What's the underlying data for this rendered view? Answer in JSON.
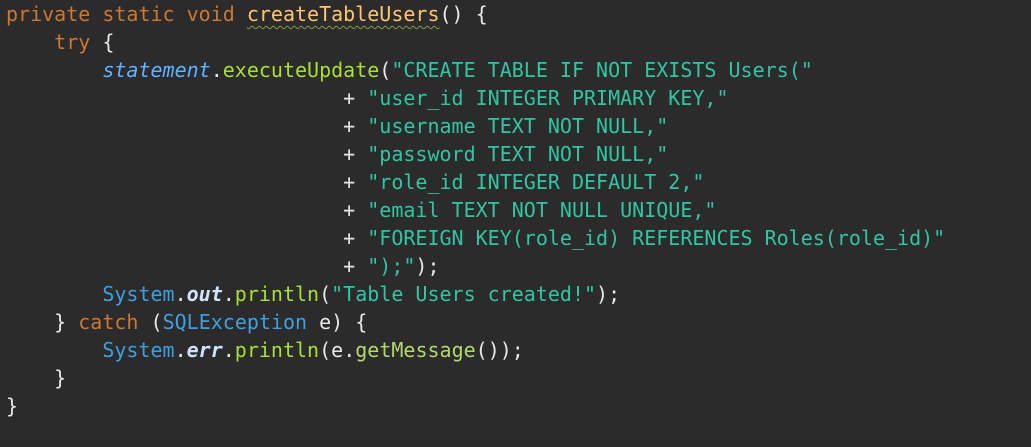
{
  "code": {
    "line1": {
      "kw": "private static void",
      "method_name": "createTableUsers",
      "rest": "() {"
    },
    "line2": {
      "kw": "try",
      "rest": "{"
    },
    "line3": {
      "field": "statement",
      "method": "executeUpdate",
      "open": "(",
      "str": "\"CREATE TABLE IF NOT EXISTS Users(\""
    },
    "concat_lines": [
      "\"user_id INTEGER PRIMARY KEY,\"",
      "\"username TEXT NOT NULL,\"",
      "\"password TEXT NOT NULL,\"",
      "\"role_id INTEGER DEFAULT 2,\"",
      "\"email TEXT NOT NULL UNIQUE,\"",
      "\"FOREIGN KEY(role_id) REFERENCES Roles(role_id)\"",
      "\");\""
    ],
    "concat_op": "+",
    "concat_end": ");",
    "line11": {
      "cls": "System",
      "field": "out",
      "method": "println",
      "str": "\"Table Users created!\"",
      "end": ");"
    },
    "line12": {
      "close": "}",
      "kw": "catch",
      "cls": "SQLException",
      "var": "e",
      "end": ") {"
    },
    "line13": {
      "cls": "System",
      "field": "err",
      "method": "println",
      "var": "e",
      "method2": "getMessage",
      "end": "());"
    },
    "line14": "}",
    "line15": "}"
  },
  "colors": {
    "background": "#2b2b2b",
    "keyword": "#cc7832",
    "method_decl": "#ffc66d",
    "string": "#2ec7a3",
    "field": "#5fb3ff",
    "class": "#3fa0e0",
    "method_call": "#a6e22e"
  }
}
